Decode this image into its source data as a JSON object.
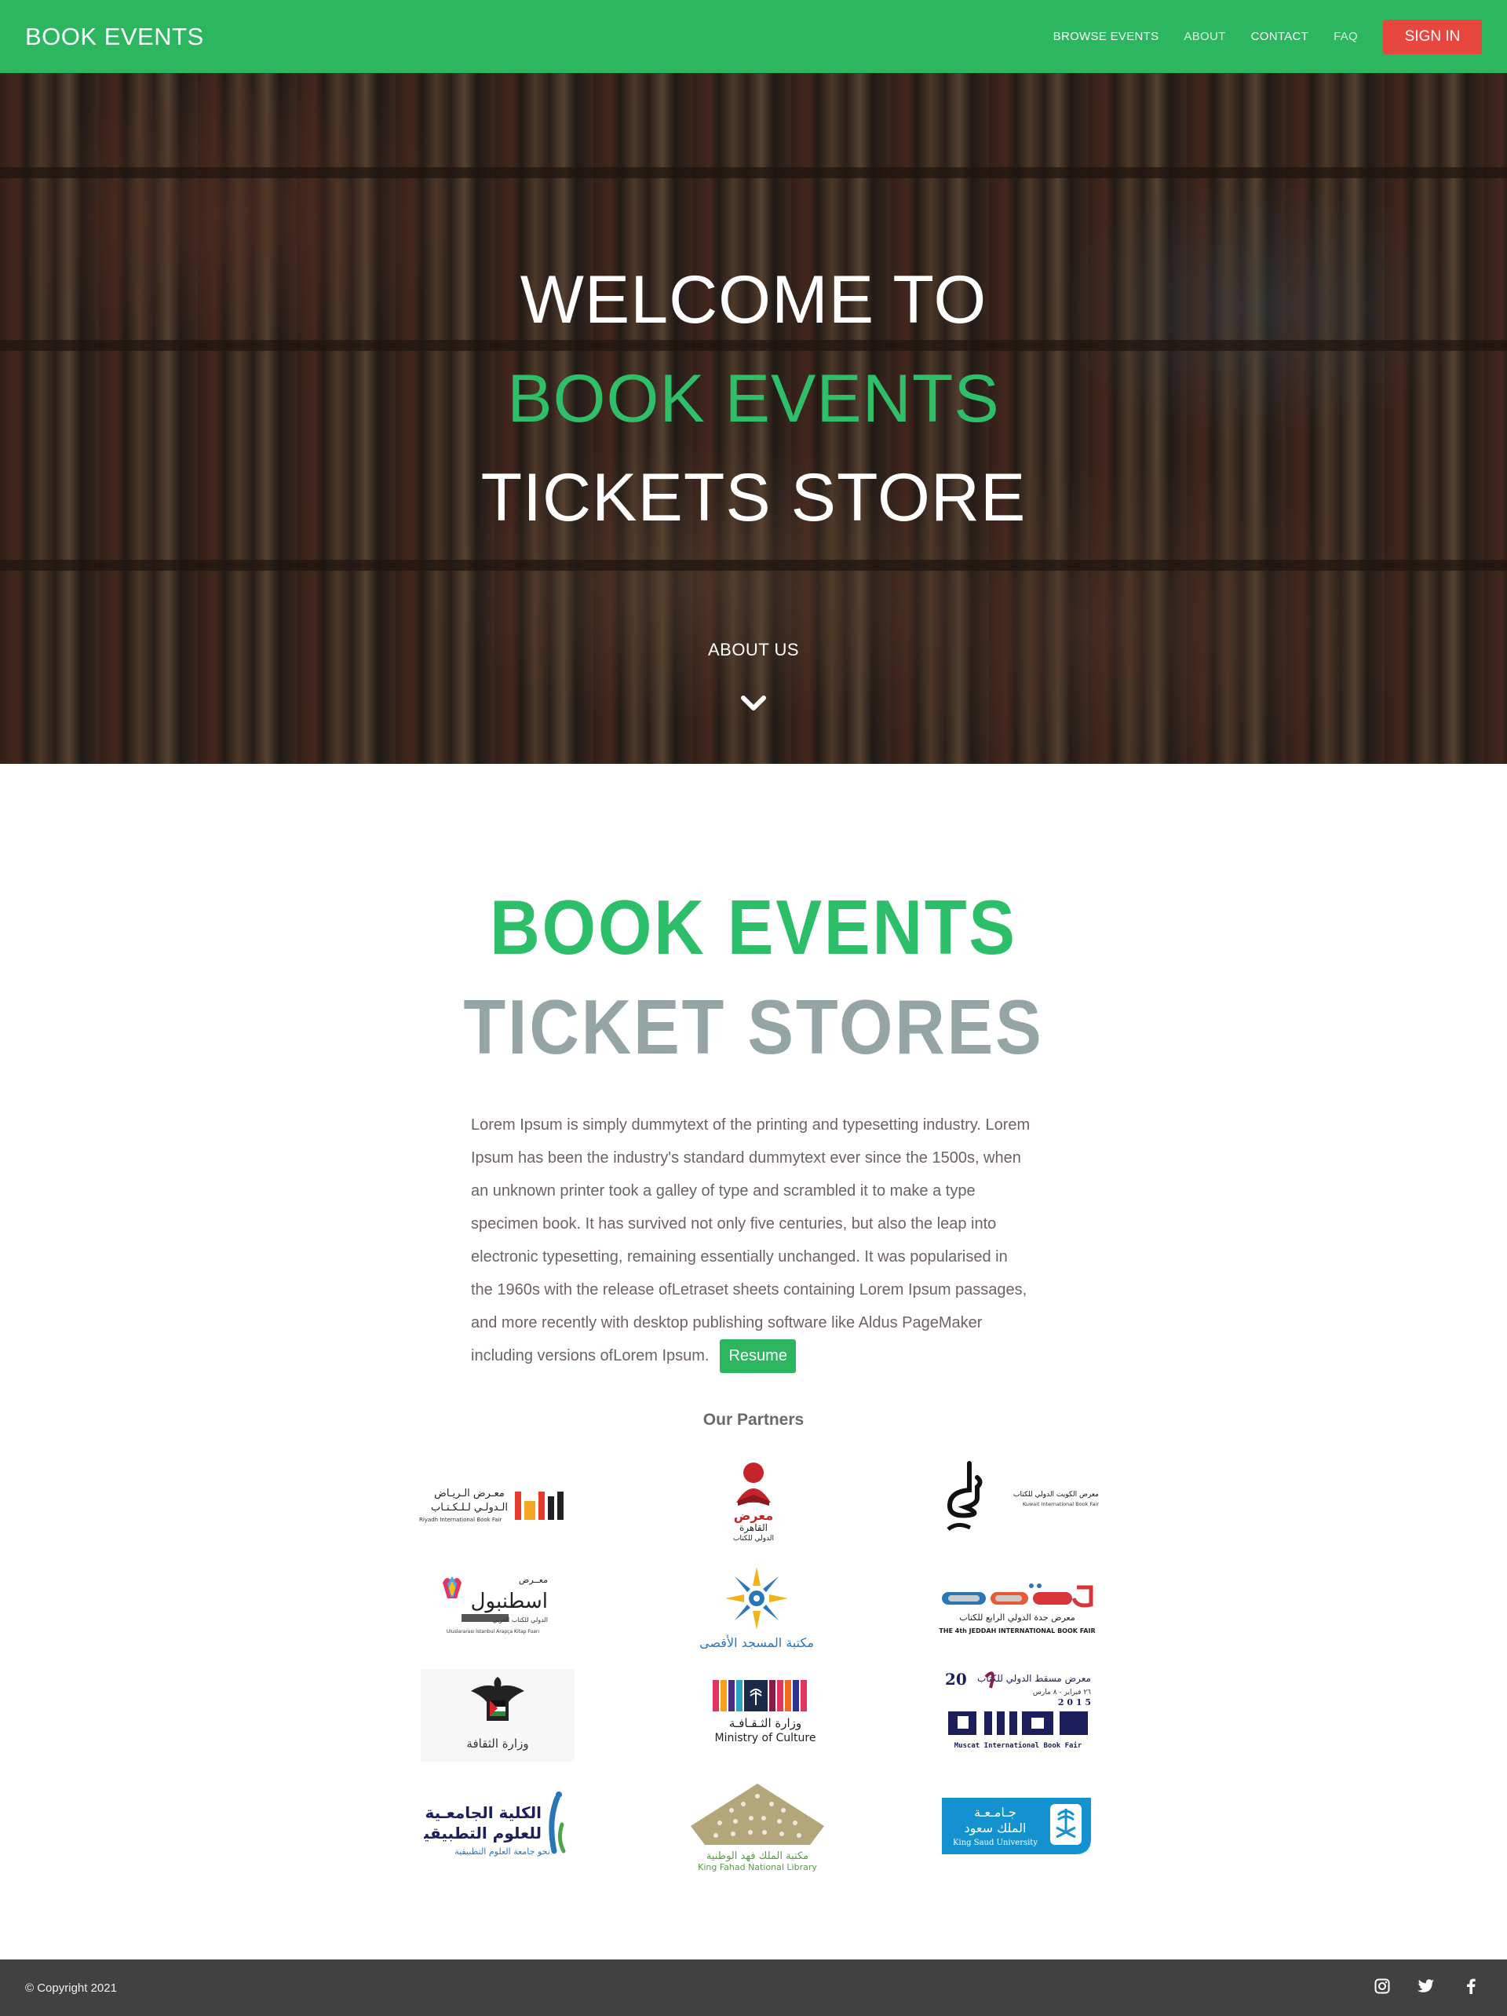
{
  "navbar": {
    "brand": "BOOK EVENTS",
    "links": [
      "BROWSE EVENTS",
      "ABOUT",
      "CONTACT",
      "FAQ"
    ],
    "signin": "SIGN IN"
  },
  "hero": {
    "line1": "WELCOME TO",
    "line2": "BOOK EVENTS",
    "line3": "TICKETS STORE",
    "about": "ABOUT US"
  },
  "intro": {
    "title1": "BOOK EVENTS",
    "title2": "TICKET STORES",
    "text": "Lorem Ipsum is simply dummytext of the printing and typesetting industry. Lorem Ipsum has been the industry's standard dummytext ever since the 1500s, when an unknown printer took a galley of type and scrambled it to make a type specimen book. It has survived not only five centuries, but also the leap into electronic typesetting, remaining essentially unchanged. It was popularised in the 1960s with the release ofLetraset sheets containing Lorem Ipsum passages, and more recently with desktop publishing software like Aldus PageMaker including versions ofLorem Ipsum.",
    "resume": "Resume"
  },
  "partners": {
    "title": "Our Partners",
    "logos": {
      "riyadh": {
        "ar1": "معـرض الـريـاض",
        "ar2": "الـدولـي لـلـكـتـاب",
        "en": "Riyadh International Book Fair"
      },
      "cairo": {
        "ar1": "معرض",
        "ar2": "القاهرة",
        "ar3": "الدولي للكتاب"
      },
      "kuwait": {
        "ar": "معرض الكويت الدولي للكتاب",
        "en": "Kuwait International Book Fair"
      },
      "istanbul": {
        "ar0": "معــرض",
        "ar1": "اسطنبول",
        "ar2": "الدولي للكتاب العربي",
        "tr": "Uluslararası İstanbul Arapça Kitap Fuarı"
      },
      "aqsa": {
        "ar": "مكتبة المسجد الأقصى"
      },
      "jeddah": {
        "ar": "معرض جدة الدولي الرابع للكتاب",
        "en": "THE 4th JEDDAH INTERNATIONAL BOOK FAIR"
      },
      "palestine": {
        "ar": "وزارة الثقافة"
      },
      "culture": {
        "ar": "وزارة الثـقـافـة",
        "en": "Ministry of Culture"
      },
      "muscat": {
        "ar": "معرض مسقط الدولي للكتاب",
        "date": "٢٦ فبراير - ٨ مارس",
        "year": "20",
        "year2": "2 0 1 5",
        "en": "Muscat International Book Fair"
      },
      "college": {
        "ar1": "الكلية الجامعـية",
        "ar2": "للعلوم التطبيقية",
        "ar3": "نحو جامعة العلوم التطبيقية"
      },
      "kfnl": {
        "ar": "مكتبة الملك فهد الوطنية",
        "en": "King Fahad National Library"
      },
      "ksu": {
        "ar1": "جـامـعـة",
        "ar2": "الملك سعود",
        "en": "King Saud University"
      }
    }
  },
  "footer": {
    "copyright": "© Copyright 2021"
  },
  "colors": {
    "brand_green": "#2cb65f",
    "signin_red": "#e8473f",
    "title_gray": "#95a5a6",
    "footer_bg": "#414141"
  },
  "icons": [
    "chevron-down-icon",
    "instagram-icon",
    "twitter-icon",
    "facebook-icon"
  ]
}
